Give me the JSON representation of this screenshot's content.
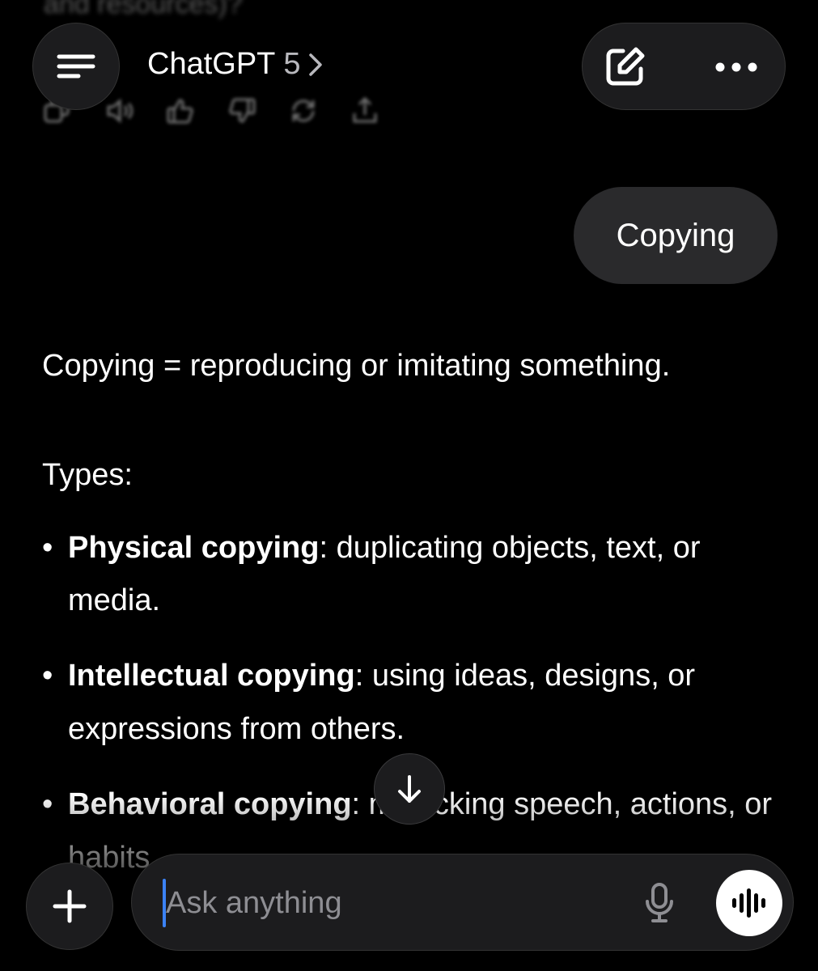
{
  "previous": {
    "faded_text": "and resources)?",
    "actions": [
      "copy-icon",
      "speaker-icon",
      "thumbs-up-icon",
      "thumbs-down-icon",
      "regenerate-icon",
      "share-icon"
    ]
  },
  "header": {
    "title": "ChatGPT",
    "version": "5",
    "chevron": "›",
    "menu_icon": "menu-icon",
    "compose_icon": "compose-icon",
    "more_icon": "more-icon"
  },
  "user_message": "Copying",
  "answer": {
    "definition": "Copying = reproducing or imitating something.",
    "types_heading": "Types:",
    "types": [
      {
        "term": "Physical copying",
        "desc": ": duplicating objects, text, or media."
      },
      {
        "term": "Intellectual copying",
        "desc": ": using ideas, designs, or expressions from others."
      },
      {
        "term": "Behavioral copying",
        "desc": ": mimicking speech, actions, or habits."
      }
    ]
  },
  "composer": {
    "placeholder": "Ask anything",
    "plus_icon": "plus-icon",
    "mic_icon": "mic-icon",
    "voice_icon": "voice-mode-icon"
  },
  "colors": {
    "background": "#000000",
    "surface": "#1c1c1e",
    "bubble": "#2a2a2c",
    "caret": "#3b82f6",
    "placeholder": "#8e8e93"
  }
}
